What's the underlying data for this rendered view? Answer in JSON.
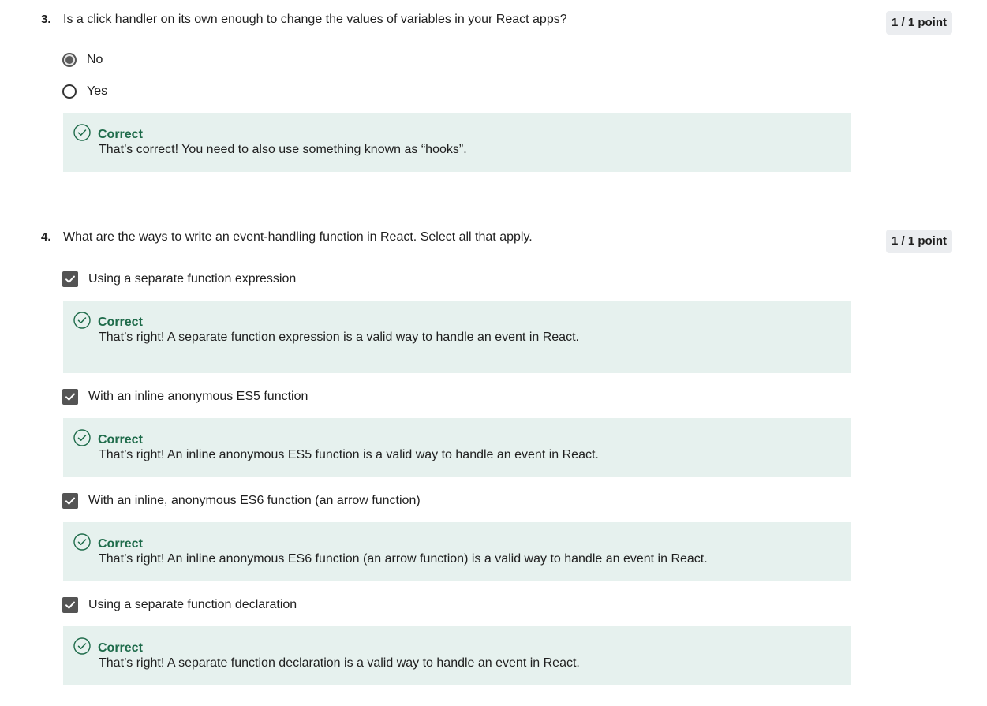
{
  "questions": [
    {
      "number": "3.",
      "text": "Is a click handler on its own enough to change the values of variables in your React apps?",
      "points": "1 / 1 point",
      "type": "radio",
      "options": [
        {
          "label": "No",
          "selected": true
        },
        {
          "label": "Yes",
          "selected": false
        }
      ],
      "feedback": [
        {
          "title": "Correct",
          "text": "That’s correct! You need to also use something known as “hooks”."
        }
      ]
    },
    {
      "number": "4.",
      "text": "What are the ways to write an event-handling function in React. Select all that apply.",
      "points": "1 / 1 point",
      "type": "checkbox",
      "options": [
        {
          "label": "Using a separate function expression",
          "checked": true
        },
        {
          "label": "With an inline anonymous ES5 function",
          "checked": true
        },
        {
          "label": "With an inline, anonymous ES6 function (an arrow function)",
          "checked": true
        },
        {
          "label": "Using a separate function declaration",
          "checked": true
        }
      ],
      "feedback": [
        {
          "title": "Correct",
          "text": "That’s right! A separate function expression is a valid way to handle an event in React."
        },
        {
          "title": "Correct",
          "text": "That’s right! An inline anonymous ES5 function is a valid way to handle an event in React."
        },
        {
          "title": "Correct",
          "text": "That’s right! An inline anonymous ES6 function (an arrow function) is a valid way to handle an event in React."
        },
        {
          "title": "Correct",
          "text": "That’s right! A separate function declaration is a valid way to handle an event in React."
        }
      ]
    }
  ],
  "icons": {
    "feedback": "check-circle-icon",
    "checkbox": "checkmark-icon"
  },
  "colors": {
    "correct": "#1e6b4a",
    "feedback_bg": "#e6f1ee",
    "points_bg": "#ebedf0",
    "checkbox": "#545454"
  }
}
